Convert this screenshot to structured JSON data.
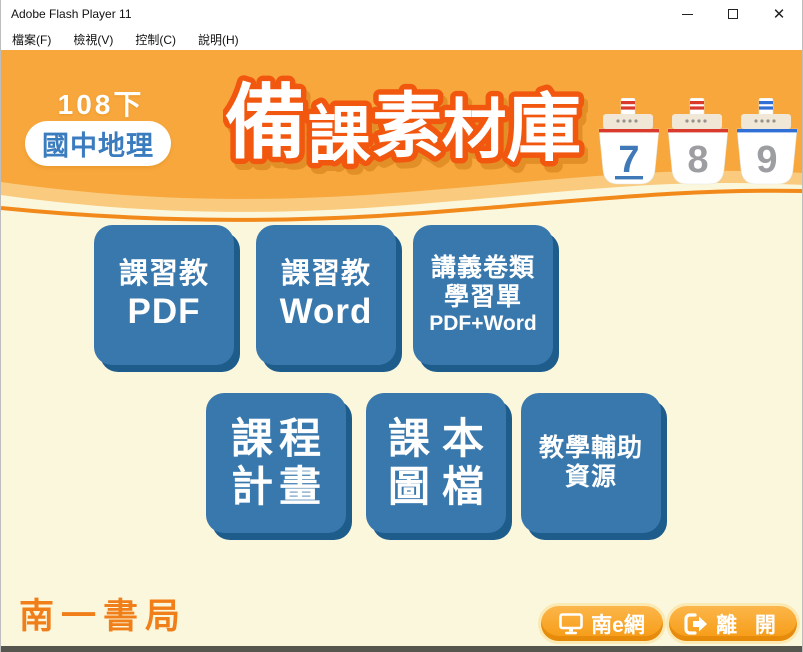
{
  "window": {
    "title": "Adobe Flash Player 11",
    "controls": {
      "minimize": "minimize",
      "maximize": "maximize",
      "close": "✕"
    }
  },
  "menu_bar": {
    "items": [
      "檔案(F)",
      "檢視(V)",
      "控制(C)",
      "說明(H)"
    ]
  },
  "header": {
    "edition_label": "108下",
    "subject_label": "國中地理",
    "title": "備課素材庫",
    "title_chars": [
      "備",
      "課",
      "素",
      "材",
      "庫"
    ],
    "boats": [
      {
        "number": "7",
        "stripe_color": "#D93A2B",
        "number_color": "#3F79B8",
        "selected": true
      },
      {
        "number": "8",
        "stripe_color": "#D93A2B",
        "number_color": "#9C9EA1",
        "selected": false
      },
      {
        "number": "9",
        "stripe_color": "#2F6FD6",
        "number_color": "#9C9EA1",
        "selected": false
      }
    ]
  },
  "main_buttons": [
    {
      "name": "textbook-pdf",
      "lines": [
        "課習教",
        "PDF"
      ]
    },
    {
      "name": "textbook-word",
      "lines": [
        "課習教",
        "Word"
      ]
    },
    {
      "name": "handouts-worksheets",
      "lines": [
        "講義卷類",
        "學習單",
        "PDF+Word"
      ]
    },
    {
      "name": "curriculum-plan",
      "lines": [
        "課程",
        "計畫"
      ]
    },
    {
      "name": "textbook-images",
      "lines": [
        "課本",
        "圖檔"
      ]
    },
    {
      "name": "teaching-resources",
      "lines": [
        "教學輔助",
        "資源"
      ]
    }
  ],
  "footer": {
    "brand": "南一書局",
    "nan_e_label": "南e網",
    "exit_label": "離 開"
  },
  "colors": {
    "header_orange": "#F7A73C",
    "wave_light": "#FACB7E",
    "wave_line": "#F2891B",
    "background_cream": "#FBF7DC",
    "button_blue": "#3878AD",
    "button_blue_shadow": "#1E5C8C",
    "accent_orange": "#F1570E",
    "footer_orange": "#F69A12",
    "subject_blue": "#3B7CBF"
  }
}
